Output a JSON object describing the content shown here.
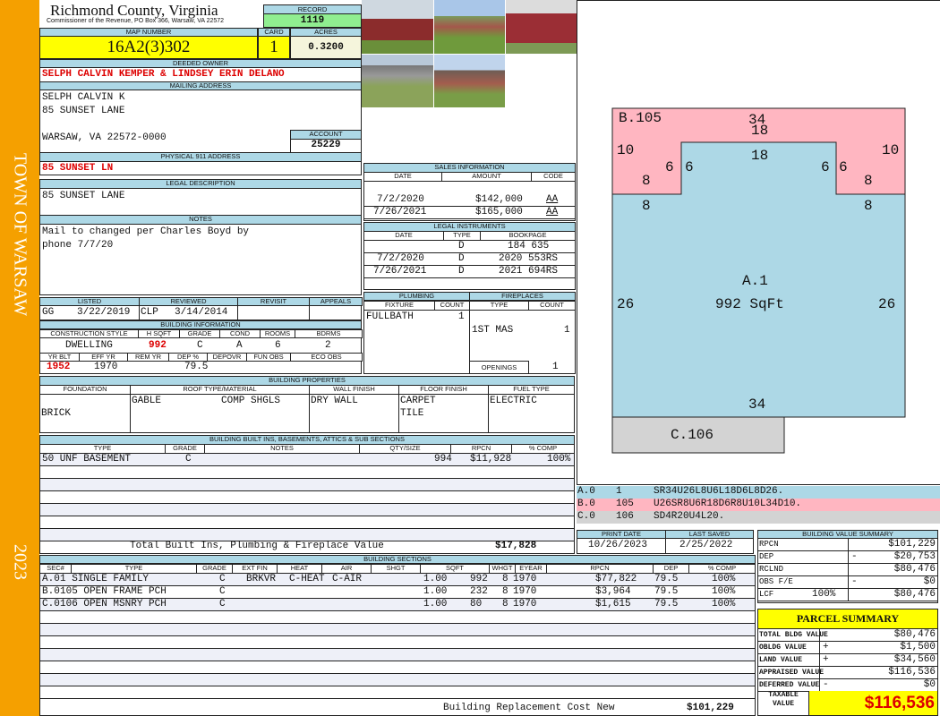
{
  "side": {
    "town": "TOWN OF WARSAW",
    "year": "2023"
  },
  "header": {
    "title": "Richmond County, Virginia",
    "subtitle": "Commissioner of the Revenue, PO Box 366, Warsaw, VA 22572",
    "record_label": "RECORD",
    "record": "1119"
  },
  "parcel": {
    "map_label": "MAP NUMBER",
    "map": "16A2(3)302",
    "card_label": "CARD",
    "card": "1",
    "acres_label": "ACRES",
    "acres": "0.3200"
  },
  "owner": {
    "label": "DEEDED OWNER",
    "value": "SELPH CALVIN KEMPER & LINDSEY ERIN DELANO"
  },
  "mailing": {
    "label": "MAILING ADDRESS",
    "line1": "SELPH CALVIN K",
    "line2": "85 SUNSET LANE",
    "line3": "WARSAW, VA 22572-0000",
    "account_label": "ACCOUNT",
    "account": "25229"
  },
  "physical": {
    "label": "PHYSICAL 911 ADDRESS",
    "value": "85 SUNSET LN"
  },
  "legal": {
    "label": "LEGAL DESCRIPTION",
    "value": "85 SUNSET LANE"
  },
  "notes": {
    "label": "NOTES",
    "line1": "Mail to changed per Charles Boyd by",
    "line2": "phone 7/7/20"
  },
  "sales": {
    "label": "SALES INFORMATION",
    "cols": [
      "DATE",
      "AMOUNT",
      "CODE"
    ],
    "rows": [
      {
        "date": "7/2/2020",
        "amount": "$142,000",
        "code": "AA"
      },
      {
        "date": "7/26/2021",
        "amount": "$165,000",
        "code": "AA"
      }
    ]
  },
  "instruments": {
    "label": "LEGAL INSTRUMENTS",
    "cols": [
      "DATE",
      "TYPE",
      "BOOKPAGE"
    ],
    "rows": [
      {
        "date": "",
        "type": "D",
        "book": "184 635"
      },
      {
        "date": "7/2/2020",
        "type": "D",
        "book": "2020 553RS"
      },
      {
        "date": "7/26/2021",
        "type": "D",
        "book": "2021 694RS"
      }
    ]
  },
  "review": {
    "cols": [
      "LISTED",
      "REVIEWED",
      "REVISIT",
      "APPEALS"
    ],
    "listed_by": "GG",
    "listed": "3/22/2019",
    "reviewed_by": "CLP",
    "reviewed": "3/14/2014"
  },
  "bldg": {
    "label": "BUILDING INFORMATION",
    "cols1": [
      "CONSTRUCTION STYLE",
      "H SQFT",
      "GRADE",
      "COND",
      "ROOMS",
      "BDRMS"
    ],
    "style": "DWELLING",
    "hsqft": "992",
    "grade": "C",
    "cond": "A",
    "rooms": "6",
    "bdrms": "2",
    "cols2": [
      "YR BLT",
      "EFF YR",
      "REM YR",
      "DEP %",
      "DEPOVR",
      "FUN OBS",
      "ECO OBS"
    ],
    "yrblt": "1952",
    "effyr": "1970",
    "dep": "79.5"
  },
  "plumbing": {
    "label": "PLUMBING",
    "cols": [
      "FIXTURE",
      "COUNT"
    ],
    "fixture": "FULLBATH",
    "count": "1"
  },
  "fireplaces": {
    "label": "FIREPLACES",
    "cols": [
      "TYPE",
      "COUNT"
    ],
    "type": "1ST MAS",
    "count": "1",
    "openings_label": "OPENINGS",
    "openings": "1"
  },
  "props": {
    "label": "BUILDING PROPERTIES",
    "cols": [
      "FOUNDATION",
      "ROOF TYPE/MATERIAL",
      "WALL FINISH",
      "FLOOR FINISH",
      "FUEL TYPE"
    ],
    "foundation": "BRICK",
    "roof_type": "GABLE",
    "roof_mat": "COMP SHGLS",
    "wall": "DRY WALL",
    "floor1": "CARPET",
    "floor2": "TILE",
    "fuel": "ELECTRIC"
  },
  "builtins": {
    "label": "BUILDING BUILT INS, BASEMENTS, ATTICS & SUB SECTIONS",
    "cols": [
      "TYPE",
      "GRADE",
      "NOTES",
      "QTY/SIZE",
      "RPCN",
      "% COMP"
    ],
    "row": {
      "type": "50 UNF BASEMENT",
      "grade": "C",
      "qty": "994",
      "rpcn": "$11,928",
      "comp": "100%"
    },
    "total_label": "Total Built Ins, Plumbing & Fireplace Value",
    "total": "$17,828"
  },
  "dates": {
    "print_label": "PRINT DATE",
    "print": "10/26/2023",
    "saved_label": "LAST SAVED",
    "saved": "2/25/2022"
  },
  "sections": {
    "label": "BUILDING SECTIONS",
    "cols": [
      "SEC#",
      "TYPE",
      "GRADE",
      "EXT FIN",
      "HEAT",
      "AIR",
      "SHGT",
      "SQFT",
      "WHGT",
      "EYEAR",
      "RPCN",
      "DEP",
      "% COMP"
    ],
    "rows": [
      {
        "sec": "A.0",
        "type": "1 SINGLE FAMILY",
        "grade": "C",
        "ext": "BRKVR",
        "heat": "C-HEAT",
        "air": "C-AIR",
        "shgt": "1.00",
        "sqft": "992",
        "whgt": "8",
        "eyear": "1970",
        "rpcn": "$77,822",
        "dep": "79.5",
        "comp": "100%"
      },
      {
        "sec": "B.0",
        "type": "105 OPEN FRAME PCH",
        "grade": "C",
        "ext": "",
        "heat": "",
        "air": "",
        "shgt": "1.00",
        "sqft": "232",
        "whgt": "8",
        "eyear": "1970",
        "rpcn": "$3,964",
        "dep": "79.5",
        "comp": "100%"
      },
      {
        "sec": "C.0",
        "type": "106 OPEN MSNRY PCH",
        "grade": "C",
        "ext": "",
        "heat": "",
        "air": "",
        "shgt": "1.00",
        "sqft": "80",
        "whgt": "8",
        "eyear": "1970",
        "rpcn": "$1,615",
        "dep": "79.5",
        "comp": "100%"
      }
    ],
    "total_label": "Building Replacement Cost New",
    "total": "$101,229"
  },
  "sketch": {
    "b_label": "B.105",
    "a_label": "A.1",
    "a_area": "992 SqFt",
    "c_label": "C.106",
    "dims": {
      "top": "34",
      "bump_top": "18",
      "bump": "18",
      "b_side": "10",
      "b_step": "6",
      "b_inner": "8",
      "a_inner": "8",
      "a_side": "26",
      "bottom": "34"
    },
    "vectors": [
      {
        "sec": "A.0",
        "code": "1",
        "path": "SR34U26L8U6L18D6L8D26.",
        "color": "#add8e6"
      },
      {
        "sec": "B.0",
        "code": "105",
        "path": "U26SR8U6R18D6R8U10L34D10.",
        "color": "#ffb6c1"
      },
      {
        "sec": "C.0",
        "code": "106",
        "path": "SD4R20U4L20.",
        "color": "#d3d3d3"
      }
    ]
  },
  "value_summary": {
    "label": "BUILDING VALUE SUMMARY",
    "rpcn_label": "RPCN",
    "rpcn": "$101,229",
    "dep_label": "DEP",
    "dep_sign": "-",
    "dep": "$20,753",
    "rclnd_label": "RCLND",
    "rclnd": "$80,476",
    "obs_label": "OBS F/E",
    "obs_sign": "-",
    "obs": "$0",
    "lcf_label": "LCF",
    "lcf_pct": "100%",
    "lcf": "$80,476"
  },
  "parcel_summary": {
    "title": "PARCEL SUMMARY",
    "total_bldg_label": "TOTAL BLDG VALUE",
    "total_bldg": "$80,476",
    "obldg_label": "OBLDG VALUE",
    "obldg_sign": "+",
    "obldg": "$1,500",
    "land_label": "LAND VALUE",
    "land_sign": "+",
    "land": "$34,560",
    "appraised_label": "APPRAISED VALUE",
    "appraised": "$116,536",
    "deferred_label": "DEFERRED VALUE",
    "deferred_sign": "-",
    "deferred": "$0",
    "taxable_label1": "TAXABLE",
    "taxable_label2": "VALUE",
    "taxable": "$116,536"
  },
  "colors": {
    "strip": "#f5a000",
    "label_bg": "#add8e6",
    "yellow": "#ffff00",
    "green": "#90ee90",
    "pink": "#ffb6c1",
    "blue": "#add8e6",
    "grey": "#d3d3d3"
  }
}
